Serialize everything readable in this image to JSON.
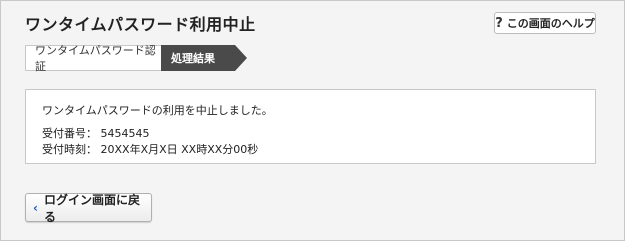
{
  "header": {
    "title": "ワンタイムパスワード利用中止",
    "help_button": {
      "icon": "question-icon",
      "icon_glyph": "?",
      "label": "この画面のヘルプ"
    }
  },
  "steps": [
    {
      "label": "ワンタイムパスワード認証",
      "active": false
    },
    {
      "label": "処理結果",
      "active": true
    }
  ],
  "result": {
    "message": "ワンタイムパスワードの利用を中止しました。",
    "receipt_number_label": "受付番号：",
    "receipt_number_value": "5454545",
    "receipt_time_label": "受付時刻：",
    "receipt_time_value": "20XX年X月X日 XX時XX分00秒"
  },
  "actions": {
    "back_button": {
      "icon": "chevron-left-icon",
      "icon_glyph": "‹",
      "label": "ログイン画面に戻る"
    }
  },
  "colors": {
    "active_step": "#4a4a4a",
    "link_accent": "#1e5db8",
    "background": "#f4f4f4"
  }
}
